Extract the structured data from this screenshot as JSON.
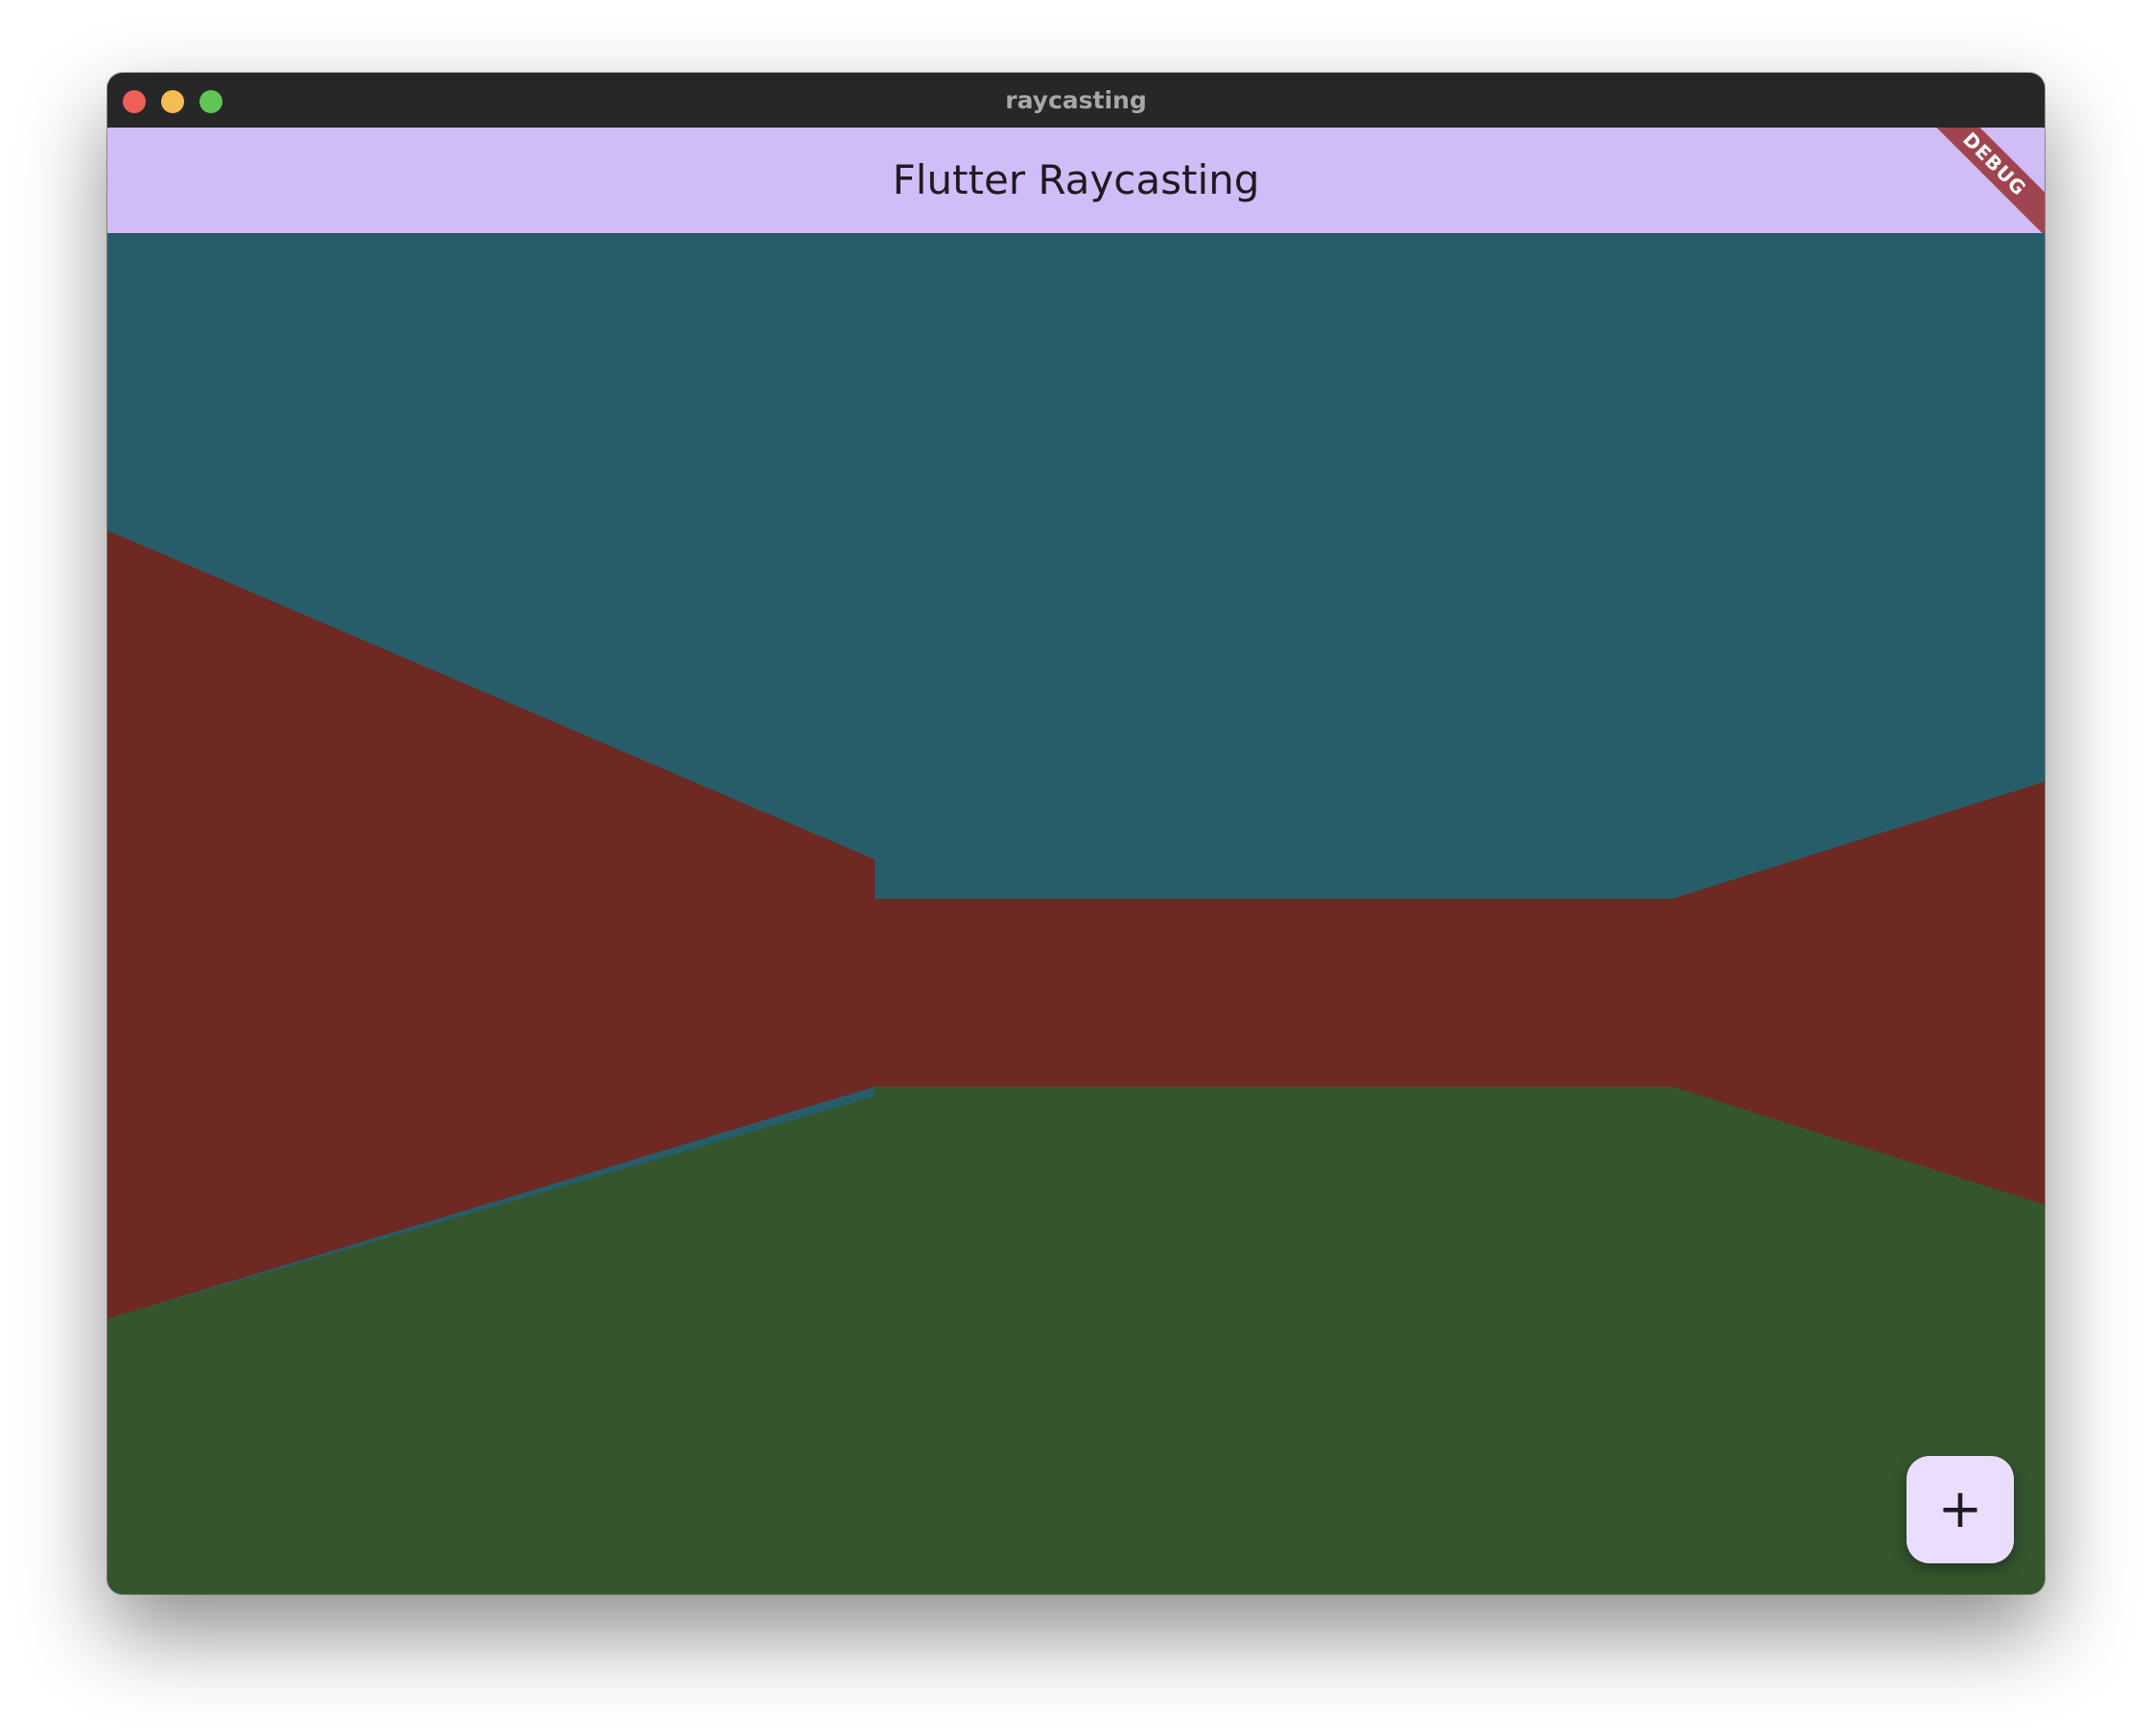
{
  "window": {
    "title": "raycasting",
    "traffic_lights": {
      "close_color": "#ee5f57",
      "minimize_color": "#f5bd4f",
      "zoom_color": "#5fc554"
    }
  },
  "appbar": {
    "title": "Flutter Raycasting",
    "background_color": "#d0bcf6"
  },
  "debug_banner": {
    "label": "DEBUG",
    "color": "#a0454f"
  },
  "scene": {
    "ceiling_color": "#265d69",
    "wall_color": "#6e2923",
    "floor_color": "#35552d"
  },
  "fab": {
    "icon": "plus-icon",
    "glyph": "+",
    "background_color": "#eaddff"
  }
}
